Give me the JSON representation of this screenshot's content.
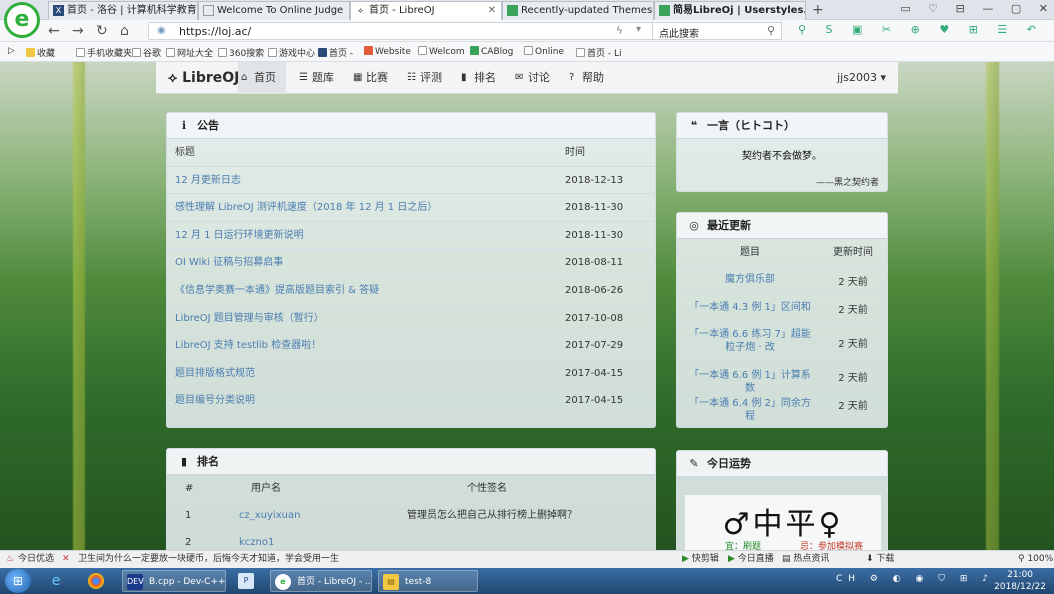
{
  "browser": {
    "tabs": [
      {
        "label": "首页 - 洛谷 | 计算机科学教育新生",
        "active": false
      },
      {
        "label": "Welcome To Online Judge",
        "active": false
      },
      {
        "label": "首页 - LibreOJ",
        "active": true
      },
      {
        "label": "Recently-updated Themes & S",
        "active": false
      },
      {
        "label": "简易LibreOj | Userstyles.org",
        "active": false
      }
    ],
    "new_tab": "+",
    "window_controls": "▭ ♡ ⊟ — ▢ ✕",
    "url": "https://loj.ac/",
    "search_text": "点此搜索",
    "bookmarks": [
      "收藏",
      "手机收藏夹",
      "谷歌",
      "网址大全",
      "360搜索",
      "游戏中心",
      "首页 -",
      "Website",
      "Welcom",
      "CABlog",
      "Online",
      "首页 - Li"
    ]
  },
  "site": {
    "logo": "LibreOJ",
    "nav": [
      "首页",
      "题库",
      "比赛",
      "评测",
      "排名",
      "讨论",
      "帮助"
    ],
    "user": "jjs2003"
  },
  "announcements": {
    "title": "公告",
    "col_title": "标题",
    "col_time": "时间",
    "rows": [
      {
        "title": "12 月更新日志",
        "time": "2018-12-13"
      },
      {
        "title": "感性理解 LibreOJ 测评机速度（2018 年 12 月 1 日之后）",
        "time": "2018-11-30"
      },
      {
        "title": "12 月 1 日运行环境更新说明",
        "time": "2018-11-30"
      },
      {
        "title": "OI Wiki 征稿与招募启事",
        "time": "2018-08-11"
      },
      {
        "title": "《信息学奥赛一本通》提高版题目索引 & 答疑",
        "time": "2018-06-26"
      },
      {
        "title": "LibreOJ 题目管理与审核（暂行）",
        "time": "2017-10-08"
      },
      {
        "title": "LibreOJ 支持 testlib 检查器啦！",
        "time": "2017-07-29"
      },
      {
        "title": "题目排版格式规范",
        "time": "2017-04-15"
      },
      {
        "title": "题目编号分类说明",
        "time": "2017-04-15"
      }
    ]
  },
  "ranking": {
    "title": "排名",
    "col_rank": "#",
    "col_user": "用户名",
    "col_sig": "个性签名",
    "rows": [
      {
        "rank": "1",
        "user": "cz_xuyixuan",
        "sig": "管理员怎么把自己从排行榜上删掉啊？"
      },
      {
        "rank": "2",
        "user": "kczno1",
        "sig": ""
      }
    ]
  },
  "hitokoto": {
    "title": "一言（ヒトコト）",
    "text": "契约者不会做梦。",
    "from": "——黑之契约者"
  },
  "recent_updates": {
    "title": "最近更新",
    "col_title": "题目",
    "col_time": "更新时间",
    "rows": [
      {
        "title": "魔方俱乐部",
        "time": "2 天前"
      },
      {
        "title": "「一本通 4.3 例 1」区间和",
        "time": "2 天前"
      },
      {
        "title": "「一本通 6.6 练习 7」超能粒子炮 · 改",
        "time": "2 天前"
      },
      {
        "title": "「一本通 6.6 例 1」计算系数",
        "time": "2 天前"
      },
      {
        "title": "「一本通 6.4 例 2」同余方程",
        "time": "2 天前"
      }
    ]
  },
  "fortune": {
    "title": "今日运势",
    "result": "♂中平♀",
    "good": "宜：刷题",
    "bad": "忌：参加模拟赛"
  },
  "statusbar": {
    "left": "今日优选",
    "news": "卫生间为什么一定要放一块硬币，后悔今天才知道，学会受用一生",
    "items": [
      "快剪辑",
      "今日直播",
      "热点资讯"
    ],
    "download": "下载",
    "zoom": "100%"
  },
  "taskbar": {
    "apps": [
      {
        "label": "B.cpp - Dev-C++",
        "icon": "DEV"
      },
      {
        "label": "首页 - LibreOJ - ...",
        "icon": "e"
      },
      {
        "label": "test-8",
        "icon": "▤"
      }
    ],
    "tray": "CH",
    "time": "21:00",
    "date": "2018/12/22"
  },
  "colors": {
    "link": "#4b7db0",
    "good": "#2a8a2a",
    "bad": "#c23a2a",
    "browser_green": "#2fae3a"
  }
}
